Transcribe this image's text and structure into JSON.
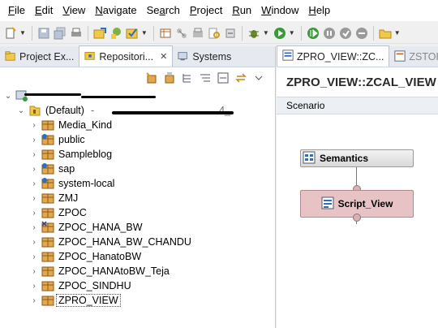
{
  "menubar": {
    "items": [
      {
        "label": "File",
        "mnemonic": "F",
        "rest": "ile"
      },
      {
        "label": "Edit",
        "mnemonic": "E",
        "rest": "dit"
      },
      {
        "label": "View",
        "mnemonic": "V",
        "rest": "iew"
      },
      {
        "label": "Navigate",
        "mnemonic": "N",
        "rest": "avigate"
      },
      {
        "label": "Search",
        "mnemonic": "a",
        "pre": "Se",
        "rest": "rch"
      },
      {
        "label": "Project",
        "mnemonic": "P",
        "rest": "roject"
      },
      {
        "label": "Run",
        "mnemonic": "R",
        "rest": "un"
      },
      {
        "label": "Window",
        "mnemonic": "W",
        "rest": "indow"
      },
      {
        "label": "Help",
        "mnemonic": "H",
        "rest": "elp"
      }
    ]
  },
  "left_panel": {
    "tabs": [
      {
        "label": "Project Ex...",
        "icon": "project-explorer-icon"
      },
      {
        "label": "Repositori...",
        "icon": "repository-icon",
        "active": true,
        "close": "✕"
      },
      {
        "label": "Systems",
        "icon": "systems-icon"
      }
    ],
    "tree": {
      "system_label": "",
      "workspace_label": "(Default)",
      "workspace_suffix": "-",
      "workspace_tail": "4_",
      "packages": [
        {
          "label": "Media_Kind",
          "icon": "package-icon"
        },
        {
          "label": "public",
          "icon": "package-special-icon"
        },
        {
          "label": "Sampleblog",
          "icon": "package-icon"
        },
        {
          "label": "sap",
          "icon": "package-special-icon"
        },
        {
          "label": "system-local",
          "icon": "package-special-icon"
        },
        {
          "label": "ZMJ",
          "icon": "package-icon"
        },
        {
          "label": "ZPOC",
          "icon": "package-icon"
        },
        {
          "label": "ZPOC_HANA_BW",
          "icon": "package-x-icon"
        },
        {
          "label": "ZPOC_HANA_BW_CHANDU",
          "icon": "package-icon"
        },
        {
          "label": "ZPOC_HanatoBW",
          "icon": "package-icon"
        },
        {
          "label": "ZPOC_HANAtoBW_Teja",
          "icon": "package-icon"
        },
        {
          "label": "ZPOC_SINDHU",
          "icon": "package-icon"
        },
        {
          "label": "ZPRO_VIEW",
          "icon": "package-icon",
          "selected": true
        }
      ]
    }
  },
  "right_panel": {
    "tabs": [
      {
        "label": "ZPRO_VIEW::ZC...",
        "icon": "calc-view-icon",
        "active": true
      },
      {
        "label": "ZSTORI",
        "icon": "calc-view-icon"
      }
    ],
    "title": "ZPRO_VIEW::ZCAL_VIEW",
    "scenario_label": "Scenario",
    "nodes": {
      "semantics": "Semantics",
      "script": "Script_View"
    }
  },
  "colors": {
    "script_node_fill": "#e7c3c6",
    "semantics_node_fill": "#d9d9d9",
    "tab_strip": "#e6eaf0"
  }
}
